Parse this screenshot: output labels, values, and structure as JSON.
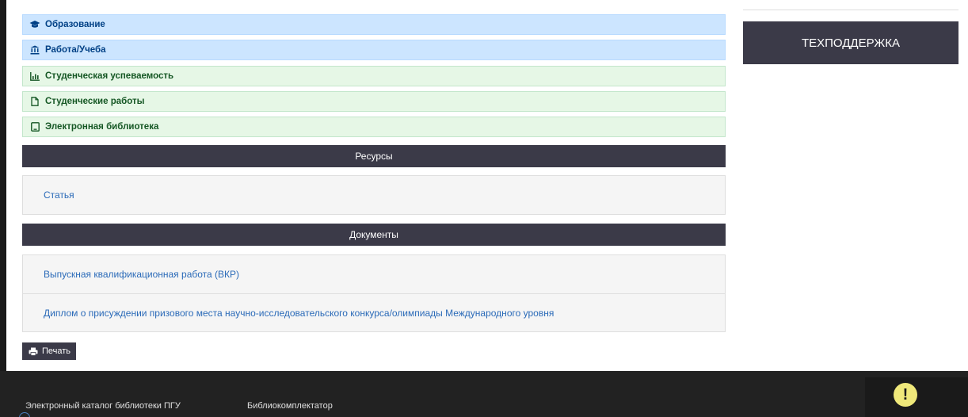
{
  "sections": [
    {
      "label": "Образование",
      "icon": "graduation-cap-icon"
    },
    {
      "label": "Работа/Учеба",
      "icon": "institution-icon"
    },
    {
      "label": "Студенческая успеваемость",
      "icon": "bar-chart-icon"
    },
    {
      "label": "Студенческие работы",
      "icon": "file-icon"
    },
    {
      "label": "Электронная библиотека",
      "icon": "tablet-icon"
    }
  ],
  "resources": {
    "title": "Ресурсы",
    "items": [
      "Статья"
    ]
  },
  "documents": {
    "title": "Документы",
    "items": [
      "Выпускная квалификационная работа (ВКР)",
      "Диплом о присуждении призового места научно-исследовательского конкурса/олимпиады Международного уровня"
    ]
  },
  "print_label": "Печать",
  "support_label": "ТЕХПОДДЕРЖКА",
  "footer": {
    "links": [
      "Электронный каталог библиотеки ПГУ",
      "Библиокомплектатор"
    ],
    "alert_symbol": "!"
  },
  "colors": {
    "dark_header": "#3b3a48",
    "blue_row": "#cce5ff",
    "green_row": "#e6f7e6",
    "link": "#2a6ab8",
    "footer_bg": "#222222",
    "alert": "#efe87a"
  }
}
